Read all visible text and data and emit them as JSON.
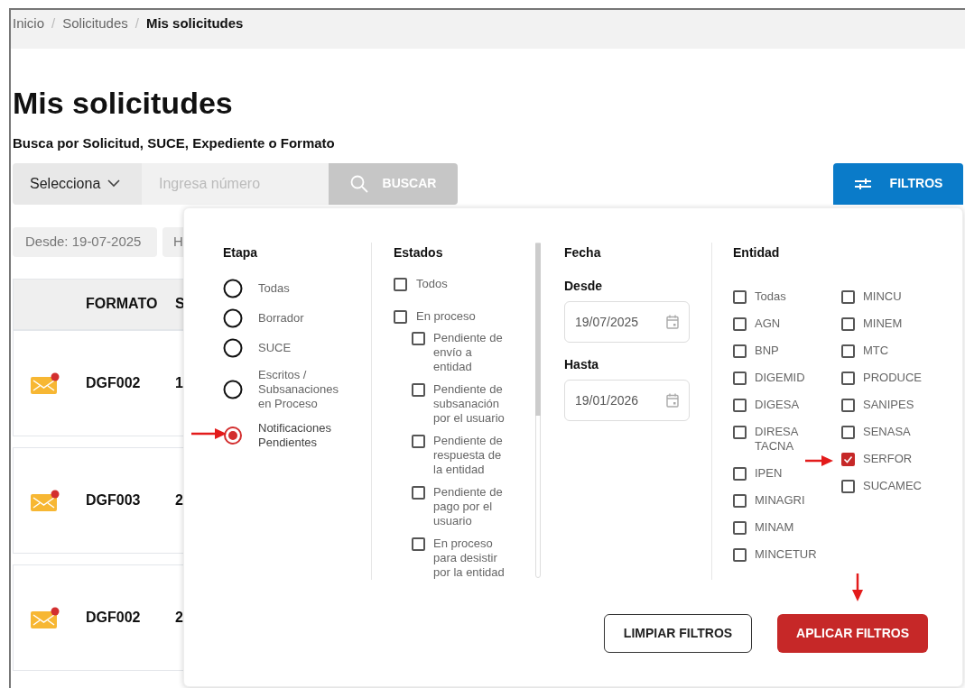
{
  "breadcrumb": [
    {
      "label": "Inicio",
      "kind": "link"
    },
    {
      "label": "/",
      "kind": "separator"
    },
    {
      "label": "Solicitudes",
      "kind": "link"
    },
    {
      "label": "/",
      "kind": "separator"
    },
    {
      "label": "Mis solicitudes",
      "kind": "current"
    }
  ],
  "title": "Mis solicitudes",
  "search": {
    "label": "Busca por Solicitud, SUCE, Expediente o Formato",
    "select": "Selecciona",
    "placeholder": "Ingresa número",
    "button": "BUSCAR"
  },
  "filters_button": {
    "label": "FILTROS",
    "expanded": true
  },
  "chips": [
    "Desde: 19-07-2025",
    "H"
  ],
  "table": {
    "columns": [
      "FORMATO",
      "S"
    ],
    "rows": [
      {
        "notification": true,
        "formato": "DGF002",
        "column_3": "1"
      },
      {
        "notification": true,
        "formato": "DGF003",
        "column_3": "2"
      },
      {
        "notification": true,
        "formato": "DGF002",
        "column_3": "2"
      }
    ]
  },
  "filter_panel": {
    "etapa": {
      "title": "Etapa",
      "options": [
        {
          "label": "Todas",
          "selected": false
        },
        {
          "label": "Borrador",
          "selected": false
        },
        {
          "label": "SUCE",
          "selected": false
        },
        {
          "label": "Escritos / Subsanaciones en Proceso",
          "selected": false
        },
        {
          "label": "Notificaciones Pendientes",
          "selected": true
        }
      ]
    },
    "estados": {
      "title": "Estados",
      "items": [
        {
          "label": "Todos",
          "checked": false
        },
        {
          "label": "En proceso",
          "checked": false,
          "children": [
            {
              "label": "Pendiente de envío a entidad",
              "checked": false
            },
            {
              "label": "Pendiente de subsanación por el usuario",
              "checked": false
            },
            {
              "label": "Pendiente de respuesta de la entidad",
              "checked": false
            },
            {
              "label": "Pendiente de pago por el usuario",
              "checked": false
            },
            {
              "label": "En proceso para desistir por la entidad",
              "checked": false
            }
          ]
        }
      ]
    },
    "fecha": {
      "title": "Fecha",
      "fields": [
        {
          "label": "Desde",
          "value": "19/07/2025"
        },
        {
          "label": "Hasta",
          "value": "19/01/2026"
        }
      ]
    },
    "entidad": {
      "title": "Entidad",
      "columns": [
        {
          "items": [
            {
              "label": "Todas",
              "checked": false
            },
            {
              "label": "AGN",
              "checked": false
            },
            {
              "label": "BNP",
              "checked": false
            },
            {
              "label": "DIGEMID",
              "checked": false
            },
            {
              "label": "DIGESA",
              "checked": false
            },
            {
              "label": "DIRESA TACNA",
              "checked": false
            },
            {
              "label": "IPEN",
              "checked": false
            },
            {
              "label": "MINAGRI",
              "checked": false
            },
            {
              "label": "MINAM",
              "checked": false
            },
            {
              "label": "MINCETUR",
              "checked": false
            }
          ]
        },
        {
          "items": [
            {
              "label": "MINCU",
              "checked": false
            },
            {
              "label": "MINEM",
              "checked": false
            },
            {
              "label": "MTC",
              "checked": false
            },
            {
              "label": "PRODUCE",
              "checked": false
            },
            {
              "label": "SANIPES",
              "checked": false
            },
            {
              "label": "SENASA",
              "checked": false
            },
            {
              "label": "SERFOR",
              "checked": true
            },
            {
              "label": "SUCAMEC",
              "checked": false
            }
          ]
        }
      ]
    },
    "buttons": [
      {
        "label": "LIMPIAR FILTROS",
        "kind": "secondary"
      },
      {
        "label": "APLICAR FILTROS",
        "kind": "primary"
      }
    ]
  }
}
